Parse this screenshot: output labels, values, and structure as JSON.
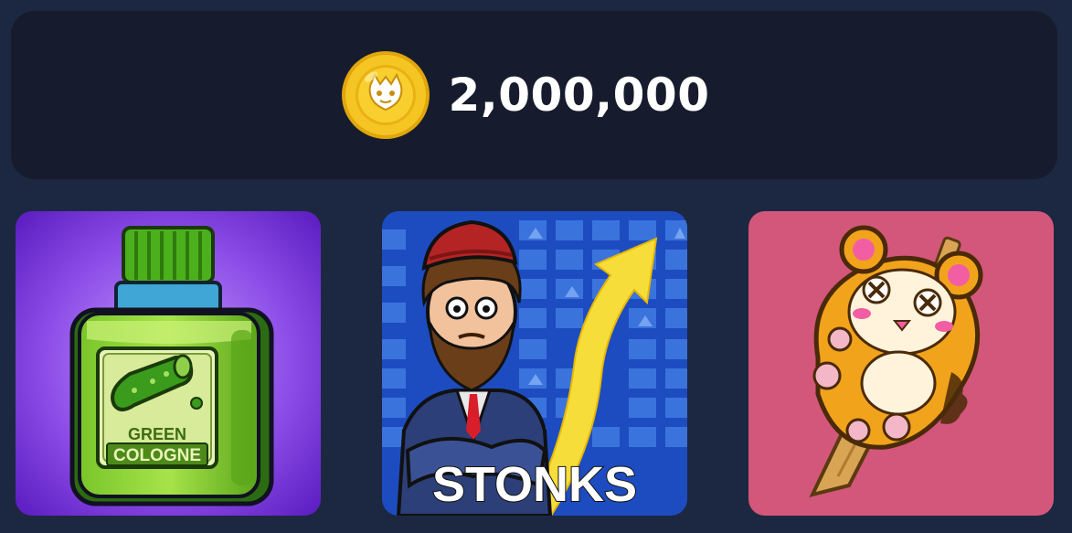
{
  "balance": {
    "coin_icon": "coin-icon",
    "value": "2,000,000"
  },
  "cards": [
    {
      "id": "green-cologne",
      "icon": "cologne-bottle-icon",
      "label_line1": "GREEN",
      "label_line2": "COLOGNE",
      "background": "#7c3bd9"
    },
    {
      "id": "stonks",
      "icon": "stonks-man-icon",
      "caption": "STONKS",
      "background": "#1d4cc1"
    },
    {
      "id": "hamster-popsicle",
      "icon": "hamster-popsicle-icon",
      "background": "#d3577a"
    }
  ],
  "colors": {
    "page_bg": "#1c2841",
    "panel_bg": "#161c2d",
    "coin_gold": "#f3c21c",
    "text": "#ffffff"
  }
}
